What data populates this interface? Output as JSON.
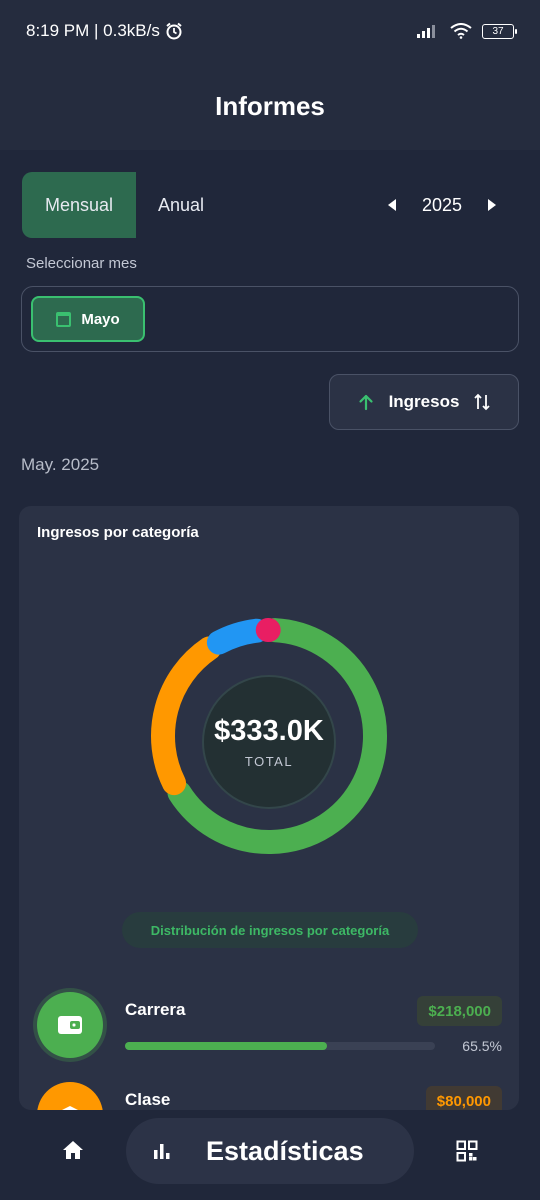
{
  "status_bar": {
    "time": "8:19 PM | 0.3kB/s",
    "battery": "37"
  },
  "header": {
    "title": "Informes"
  },
  "segment": {
    "monthly_label": "Mensual",
    "annual_label": "Anual",
    "active": "Mensual"
  },
  "year_nav": {
    "year": "2025"
  },
  "month_select": {
    "label": "Seleccionar mes",
    "selected_month": "Mayo"
  },
  "type_toggle": {
    "label": "Ingresos"
  },
  "period_label": "May. 2025",
  "card": {
    "title": "Ingresos por categoría",
    "total_value": "$333.0K",
    "total_label": "TOTAL",
    "distribution_label": "Distribución de ingresos por categoría",
    "donut_colors": [
      "#4caf50",
      "#ff9800",
      "#2196f3",
      "#e91e63"
    ],
    "donut_shares": [
      65.5,
      24.0,
      7.5,
      1.0
    ]
  },
  "categories": [
    {
      "name": "Carrera",
      "amount": "$218,000",
      "percent_label": "65.5%",
      "fraction": 0.655,
      "color": "#4caf50",
      "icon": "wallet-icon"
    },
    {
      "name": "Clase",
      "amount": "$80,000",
      "percent_label": "",
      "fraction": 0.24,
      "color": "#ff9800",
      "icon": "graduation-cap-icon"
    }
  ],
  "bottom_nav": {
    "active_label": "Estadísticas",
    "items": [
      "home-icon",
      "bar-chart-icon",
      "grid-icon"
    ]
  },
  "colors": {
    "background": "#20273a",
    "surface": "#2b3245",
    "accent_green": "#4caf50",
    "accent_orange": "#ff9800"
  }
}
